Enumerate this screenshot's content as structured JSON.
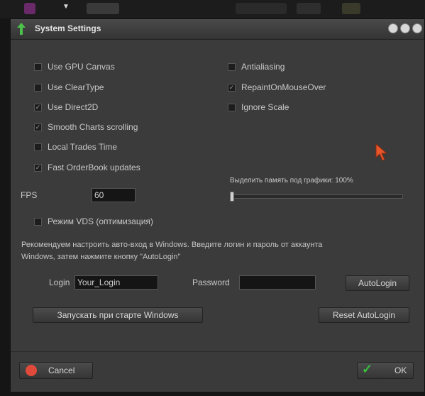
{
  "window": {
    "title": "System Settings"
  },
  "options_left": [
    {
      "label": "Use GPU Canvas",
      "checked": false
    },
    {
      "label": "Use ClearType",
      "checked": false
    },
    {
      "label": "Use Direct2D",
      "checked": true
    },
    {
      "label": "Smooth Charts scrolling",
      "checked": true
    },
    {
      "label": "Local Trades Time",
      "checked": false
    },
    {
      "label": "Fast OrderBook updates",
      "checked": true
    }
  ],
  "options_right": [
    {
      "label": "Antialiasing",
      "checked": false
    },
    {
      "label": "RepaintOnMouseOver",
      "checked": true
    },
    {
      "label": "Ignore Scale",
      "checked": false
    }
  ],
  "fps": {
    "label": "FPS",
    "value": "60"
  },
  "memory": {
    "label": "Выделить память под графики: 100%",
    "level": 0.0
  },
  "vds": {
    "label": "Режим VDS (оптимизация)",
    "checked": false
  },
  "hint": {
    "line1": "Рекомендуем настроить авто-вход в Windows. Введите логин и пароль от аккаунта",
    "line2": "Windows, затем нажмите кнопку \"AutoLogin\""
  },
  "login": {
    "label": "Login",
    "value": "Your_Login"
  },
  "password": {
    "label": "Password",
    "value": ""
  },
  "buttons": {
    "autologin": "AutoLogin",
    "startup": "Запускать при старте Windows",
    "reset": "Reset AutoLogin",
    "cancel": "Cancel",
    "ok": "OK"
  },
  "colors": {
    "accent_green": "#36c23b",
    "cancel_red": "#e04a3a",
    "cursor_orange": "#e8562a"
  }
}
